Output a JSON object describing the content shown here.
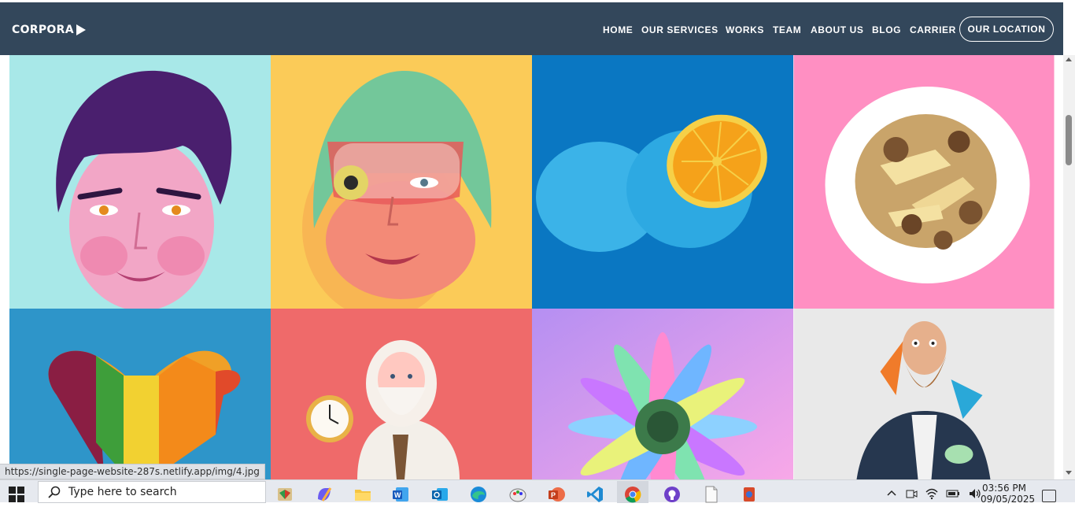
{
  "navbar": {
    "logo": "CORPORA",
    "links": [
      "HOME",
      "OUR SERVICES",
      "WORKS",
      "TEAM",
      "ABOUT US",
      "BLOG",
      "CARRIER"
    ],
    "cta": "OUR LOCATION",
    "background": "#33475b"
  },
  "gallery": {
    "tiles": [
      {
        "subject": "illustrated face with purple hair",
        "bg": "#a8e8e8"
      },
      {
        "subject": "illustrated woman in green helmet",
        "bg": "#fbcb58"
      },
      {
        "subject": "blue orange cut in half",
        "bg": "#0a77c2"
      },
      {
        "subject": "plate of potatoes and mushrooms",
        "bg": "#ff8fc2"
      },
      {
        "subject": "heart of colorful candies",
        "bg": "#2e95c9"
      },
      {
        "subject": "old man holding stopwatch",
        "bg": "#ef6a6a"
      },
      {
        "subject": "colorful flower",
        "bg": "#d8a6f2"
      },
      {
        "subject": "bearded man in suit",
        "bg": "#e9e9e9"
      }
    ]
  },
  "status_bar": {
    "url": "https://single-page-website-287s.netlify.app/img/4.jpg"
  },
  "taskbar": {
    "search_placeholder": "Type here to search",
    "apps": [
      "file-explorer",
      "copilot",
      "folder",
      "word",
      "outlook",
      "edge",
      "paint",
      "powerpoint",
      "vscode",
      "chrome",
      "github",
      "notepad",
      "app"
    ],
    "clock_time": "03:56 PM",
    "clock_date": "09/05/2025"
  }
}
